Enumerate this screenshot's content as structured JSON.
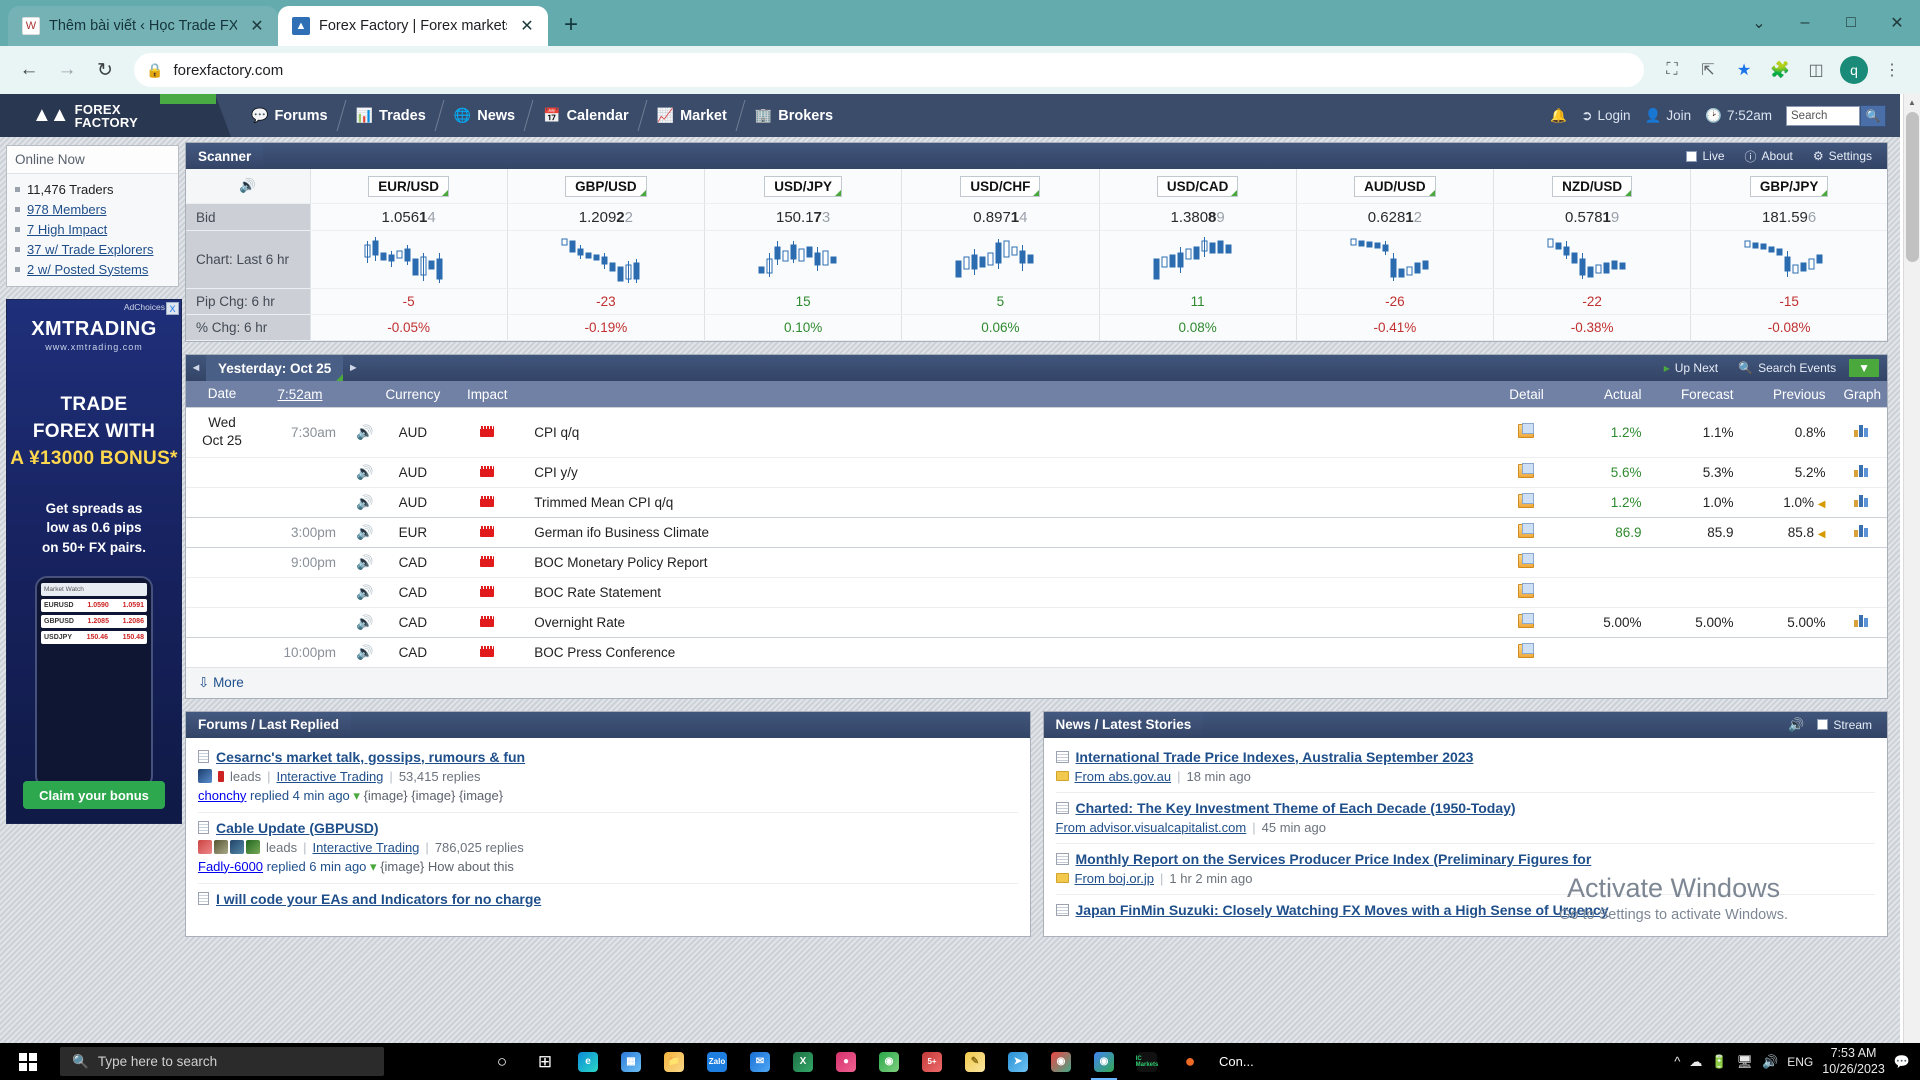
{
  "browser": {
    "tabs": [
      {
        "title": "Thêm bài viết ‹ Học Trade FX —",
        "favicon": "wordpress-icon",
        "active": false
      },
      {
        "title": "Forex Factory | Forex markets for",
        "favicon": "forexfactory-icon",
        "active": true
      }
    ],
    "new_tab_label": "+",
    "window_controls": {
      "minimize": "–",
      "maximize": "□",
      "close": "✕",
      "more": "⌄"
    },
    "nav": {
      "back": "←",
      "forward": "→",
      "reload": "↻"
    },
    "omnibox": {
      "lock": "🔒",
      "url": "forexfactory.com"
    },
    "toolbar_icons": [
      "cast-icon",
      "share-icon",
      "bookmark-star-icon",
      "extensions-icon",
      "sidepanel-icon"
    ],
    "avatar_letter": "q",
    "menu": "⋮"
  },
  "site": {
    "logo": {
      "line1": "FOREX",
      "line2": "FACTORY"
    },
    "nav": [
      {
        "label": "Forums",
        "icon": "speech-bubble-icon"
      },
      {
        "label": "Trades",
        "icon": "bar-chart-icon"
      },
      {
        "label": "News",
        "icon": "globe-icon"
      },
      {
        "label": "Calendar",
        "icon": "calendar-icon"
      },
      {
        "label": "Market",
        "icon": "line-chart-icon"
      },
      {
        "label": "Brokers",
        "icon": "building-icon"
      }
    ],
    "nav_right": {
      "bell": "bell-icon",
      "login": "Login",
      "join": "Join",
      "clock_time": "7:52am",
      "search_placeholder": "Search",
      "search_value": "Search"
    }
  },
  "sidebar": {
    "online_now_title": "Online Now",
    "items": [
      "11,476 Traders",
      "978 Members",
      "7 High Impact",
      "37 w/ Trade Explorers",
      "2 w/ Posted Systems"
    ],
    "ad": {
      "close": "X",
      "tagline": "AdChoices",
      "brand": "XMTRADING",
      "brand_sub": "www.xmtrading.com",
      "headline_l1": "TRADE",
      "headline_l2": "FOREX WITH",
      "headline_l3": "A ¥13000 BONUS*",
      "sub_l1": "Get spreads as",
      "sub_l2": "low as 0.6 pips",
      "sub_l3": "on 50+ FX pairs.",
      "phone_rows": [
        {
          "pair": "EURUSD",
          "a": "1.0590",
          "b": "1.0591"
        },
        {
          "pair": "GBPUSD",
          "a": "1.2085",
          "b": "1.2086"
        },
        {
          "pair": "USDJPY",
          "a": "150.46",
          "b": "150.48"
        }
      ],
      "cta": "Claim your bonus"
    }
  },
  "scanner": {
    "title": "Scanner",
    "buttons": {
      "live": "Live",
      "about": "About",
      "settings": "Settings"
    },
    "row_labels": {
      "speaker": "speaker-icon",
      "bid": "Bid",
      "chart": "Chart: Last 6 hr",
      "pip": "Pip Chg: 6 hr",
      "pct": "% Chg: 6 hr"
    },
    "pairs": [
      {
        "pair": "EUR/USD",
        "bid_main": "1.056",
        "bid_bold": "1",
        "bid_dim": "4",
        "pip": "-5",
        "pip_dir": "down",
        "pct": "-0.05%",
        "pct_dir": "down"
      },
      {
        "pair": "GBP/USD",
        "bid_main": "1.209",
        "bid_bold": "2",
        "bid_dim": "2",
        "pip": "-23",
        "pip_dir": "down",
        "pct": "-0.19%",
        "pct_dir": "down"
      },
      {
        "pair": "USD/JPY",
        "bid_main": "150.1",
        "bid_bold": "7",
        "bid_dim": "3",
        "pip": "15",
        "pip_dir": "up",
        "pct": "0.10%",
        "pct_dir": "up"
      },
      {
        "pair": "USD/CHF",
        "bid_main": "0.897",
        "bid_bold": "1",
        "bid_dim": "4",
        "pip": "5",
        "pip_dir": "up",
        "pct": "0.06%",
        "pct_dir": "up"
      },
      {
        "pair": "USD/CAD",
        "bid_main": "1.380",
        "bid_bold": "8",
        "bid_dim": "9",
        "pip": "11",
        "pip_dir": "up",
        "pct": "0.08%",
        "pct_dir": "up"
      },
      {
        "pair": "AUD/USD",
        "bid_main": "0.628",
        "bid_bold": "1",
        "bid_dim": "2",
        "pip": "-26",
        "pip_dir": "down",
        "pct": "-0.41%",
        "pct_dir": "down"
      },
      {
        "pair": "NZD/USD",
        "bid_main": "0.578",
        "bid_bold": "1",
        "bid_dim": "9",
        "pip": "-22",
        "pip_dir": "down",
        "pct": "-0.38%",
        "pct_dir": "down"
      },
      {
        "pair": "GBP/JPY",
        "bid_main": "181.59",
        "bid_bold": "",
        "bid_dim": "6",
        "pip": "-15",
        "pip_dir": "down",
        "pct": "-0.08%",
        "pct_dir": "down"
      }
    ]
  },
  "calendar": {
    "day_label": "Yesterday: Oct 25",
    "prev_arrow": "◄",
    "next_arrow": "►",
    "up_next": "Up Next",
    "search_events": "Search Events",
    "filter_icon": "filter-icon",
    "columns": [
      "Date",
      "7:52am",
      "Currency",
      "Impact",
      "",
      "Detail",
      "Actual",
      "Forecast",
      "Previous",
      "Graph"
    ],
    "rows": [
      {
        "date": "Wed\nOct 25",
        "time": "7:30am",
        "currency": "AUD",
        "impact": "high",
        "event": "CPI q/q",
        "detail": true,
        "actual": "1.2%",
        "actual_dir": "up",
        "forecast": "1.1%",
        "previous": "0.8%",
        "prev_revised": false,
        "graph": true,
        "daystart": true
      },
      {
        "date": "",
        "time": "",
        "currency": "AUD",
        "impact": "high",
        "event": "CPI y/y",
        "detail": true,
        "actual": "5.6%",
        "actual_dir": "up",
        "forecast": "5.3%",
        "previous": "5.2%",
        "prev_revised": false,
        "graph": true,
        "daystart": false
      },
      {
        "date": "",
        "time": "",
        "currency": "AUD",
        "impact": "high",
        "event": "Trimmed Mean CPI q/q",
        "detail": true,
        "actual": "1.2%",
        "actual_dir": "up",
        "forecast": "1.0%",
        "previous": "1.0%",
        "prev_revised": true,
        "graph": true,
        "daystart": false
      },
      {
        "date": "",
        "time": "3:00pm",
        "currency": "EUR",
        "impact": "high",
        "event": "German ifo Business Climate",
        "detail": true,
        "actual": "86.9",
        "actual_dir": "up",
        "forecast": "85.9",
        "previous": "85.8",
        "prev_revised": true,
        "graph": true,
        "daystart": true
      },
      {
        "date": "",
        "time": "9:00pm",
        "currency": "CAD",
        "impact": "high",
        "event": "BOC Monetary Policy Report",
        "detail": true,
        "actual": "",
        "actual_dir": "",
        "forecast": "",
        "previous": "",
        "prev_revised": false,
        "graph": false,
        "daystart": true
      },
      {
        "date": "",
        "time": "",
        "currency": "CAD",
        "impact": "high",
        "event": "BOC Rate Statement",
        "detail": true,
        "actual": "",
        "actual_dir": "",
        "forecast": "",
        "previous": "",
        "prev_revised": false,
        "graph": false,
        "daystart": false
      },
      {
        "date": "",
        "time": "",
        "currency": "CAD",
        "impact": "high",
        "event": "Overnight Rate",
        "detail": true,
        "actual": "5.00%",
        "actual_dir": "neutral",
        "forecast": "5.00%",
        "previous": "5.00%",
        "prev_revised": false,
        "graph": true,
        "daystart": false
      },
      {
        "date": "",
        "time": "10:00pm",
        "currency": "CAD",
        "impact": "high",
        "event": "BOC Press Conference",
        "detail": true,
        "actual": "",
        "actual_dir": "",
        "forecast": "",
        "previous": "",
        "prev_revised": false,
        "graph": false,
        "daystart": true
      }
    ],
    "more": "More"
  },
  "forums": {
    "title": "Forums / Last Replied",
    "items": [
      {
        "title": "Cesarnc's market talk, gossips, rumours & fun",
        "author": "leads",
        "forum": "Interactive Trading",
        "replies": "53,415 replies",
        "last_reply_user": "chonchy",
        "last_reply": "replied 4 min ago",
        "snippet": "{image} {image} {image}",
        "avatars": 1
      },
      {
        "title": "Cable Update (GBPUSD)",
        "author": "leads",
        "forum": "Interactive Trading",
        "replies": "786,025 replies",
        "last_reply_user": "Fadly-6000",
        "last_reply": "replied 6 min ago",
        "snippet": "{image} How about this",
        "avatars": 4
      },
      {
        "title": "I will code your EAs and Indicators for no charge",
        "author": "",
        "forum": "",
        "replies": "",
        "last_reply_user": "",
        "last_reply": "",
        "snippet": "",
        "avatars": 0
      }
    ]
  },
  "news": {
    "title": "News / Latest Stories",
    "speaker": "speaker-icon",
    "stream_label": "Stream",
    "items": [
      {
        "title": "International Trade Price Indexes, Australia September 2023",
        "source": "From abs.gov.au",
        "time": "18 min ago",
        "has_folder": true
      },
      {
        "title": "Charted: The Key Investment Theme of Each Decade (1950-Today)",
        "source": "From advisor.visualcapitalist.com",
        "time": "45 min ago",
        "has_folder": false
      },
      {
        "title": "Monthly Report on the Services Producer Price Index (Preliminary Figures for",
        "source": "From boj.or.jp",
        "time": "1 hr 2 min ago",
        "has_folder": true
      },
      {
        "title": "Japan FinMin Suzuki: Closely Watching FX Moves with a High Sense of Urgency",
        "source": "",
        "time": "",
        "has_folder": false
      }
    ]
  },
  "watermark": {
    "line1": "Activate Windows",
    "line2": "Go to Settings to activate Windows."
  },
  "taskbar": {
    "search_placeholder": "Type here to search",
    "apps": [
      "cortana-icon",
      "task-view-icon",
      "edge-icon",
      "store-icon",
      "explorer-icon",
      "zalo-icon",
      "mail-icon",
      "excel-icon",
      "app-icon",
      "chrome-alt-icon",
      "skype-icon",
      "notes-icon",
      "telegram-icon",
      "chrome-icon",
      "chrome-active-icon"
    ],
    "ic_markets": "IC Markets",
    "overflow_label": "Con...",
    "tray": [
      "chevron-up-icon",
      "onedrive-icon",
      "battery-icon",
      "network-icon",
      "volume-icon"
    ],
    "language": "ENG",
    "time": "7:53 AM",
    "date": "10/26/2023",
    "notifications": "notification-icon"
  },
  "colors": {
    "accent_blue": "#3b4c6b",
    "green": "#2f8a2f",
    "red": "#c03030",
    "link": "#1f4f8b",
    "impact_high": "#e11b1b"
  }
}
